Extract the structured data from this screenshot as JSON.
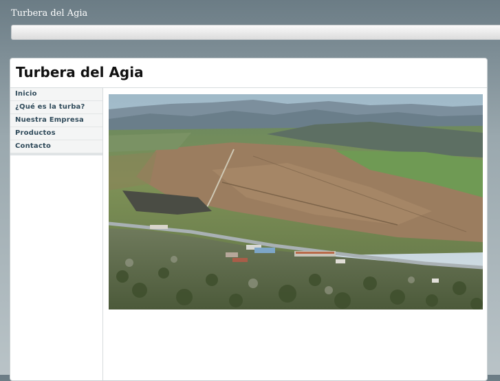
{
  "browser": {
    "title": "Turbera del Agia"
  },
  "site": {
    "title": "Turbera del Agia",
    "nav": [
      {
        "label": "Inicio"
      },
      {
        "label": "¿Qué es la turba?"
      },
      {
        "label": "Nuestra Empresa"
      },
      {
        "label": "Productos"
      },
      {
        "label": "Contacto"
      }
    ]
  },
  "colors": {
    "sky": "#b8cbd6",
    "mountain": "#6c7f8e",
    "field_green": "#6d8c4e",
    "peat_brown": "#9a7c5e",
    "road": "#9aa3a6",
    "vegetation": "#556b3a"
  }
}
